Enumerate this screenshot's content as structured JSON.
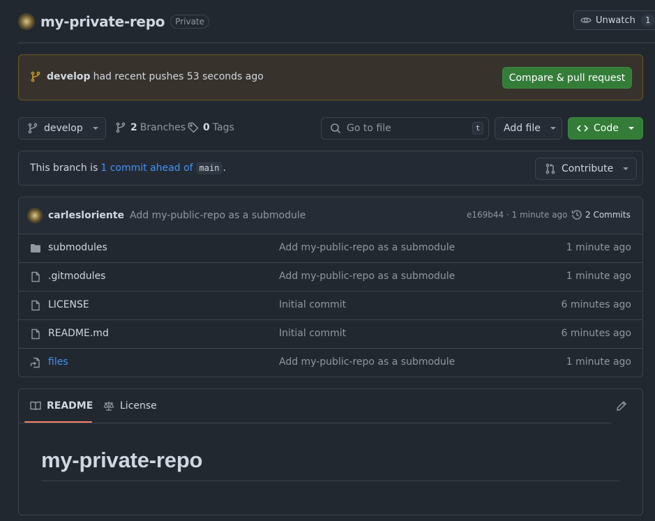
{
  "header": {
    "repo_name": "my-private-repo",
    "visibility_badge": "Private",
    "watch": {
      "label": "Unwatch",
      "count": "1",
      "icon": "eye-icon"
    }
  },
  "push_banner": {
    "branch": "develop",
    "message": "had recent pushes 53 seconds ago",
    "button_label": "Compare & pull request",
    "icon": "git-branch-icon"
  },
  "toolbar": {
    "branch_select": "develop",
    "branches_count": "2",
    "branches_label": "Branches",
    "tags_count": "0",
    "tags_label": "Tags",
    "search_placeholder": "Go to file",
    "search_shortcut": "t",
    "add_file_label": "Add file",
    "code_label": "Code"
  },
  "ahead_status": {
    "prefix": "This branch is",
    "link_text": "1 commit ahead of",
    "base_branch": "main",
    "suffix": ".",
    "contribute_label": "Contribute"
  },
  "latest_commit": {
    "author": "carlesloriente",
    "message": "Add my-public-repo as a submodule",
    "hash_and_time": "e169b44 · 1 minute ago",
    "commits_label": "2 Commits"
  },
  "files": [
    {
      "name": "submodules",
      "type": "folder",
      "icon": "folder-icon",
      "commit": "Add my-public-repo as a submodule",
      "time": "1 minute ago"
    },
    {
      "name": ".gitmodules",
      "type": "file",
      "icon": "file-icon",
      "commit": "Add my-public-repo as a submodule",
      "time": "1 minute ago"
    },
    {
      "name": "LICENSE",
      "type": "file",
      "icon": "file-icon",
      "commit": "Initial commit",
      "time": "6 minutes ago"
    },
    {
      "name": "README.md",
      "type": "file",
      "icon": "file-icon",
      "commit": "Initial commit",
      "time": "6 minutes ago"
    },
    {
      "name": "files",
      "type": "symlink",
      "icon": "file-symlink-icon",
      "commit": "Add my-public-repo as a submodule",
      "time": "1 minute ago"
    }
  ],
  "readme": {
    "tabs": [
      {
        "label": "README",
        "icon": "book-icon",
        "active": true
      },
      {
        "label": "License",
        "icon": "law-icon",
        "active": false
      }
    ],
    "title": "my-private-repo"
  },
  "colors": {
    "background": "#212830",
    "accent_green": "#347d39",
    "link_blue": "#4493f8",
    "banner_border": "#6b5a22",
    "tab_underline": "#f78166"
  }
}
